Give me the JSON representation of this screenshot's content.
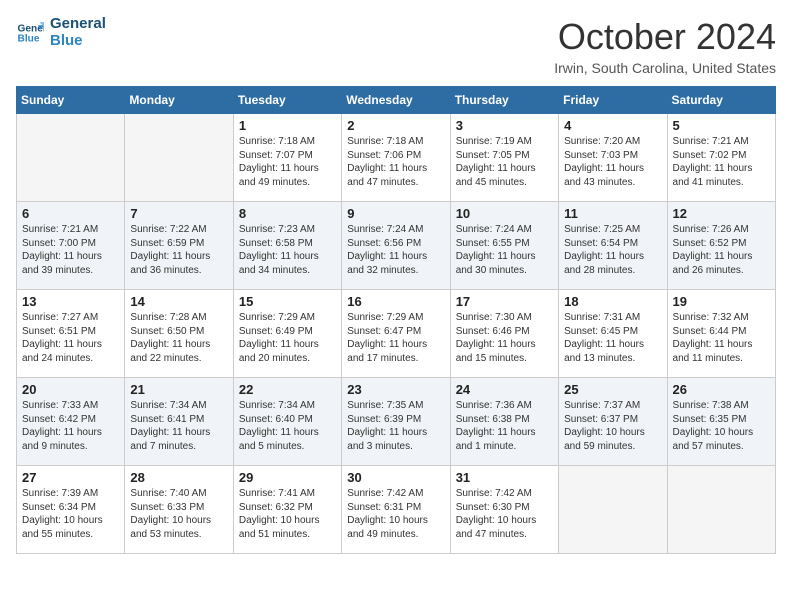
{
  "logo": {
    "line1": "General",
    "line2": "Blue"
  },
  "title": "October 2024",
  "subtitle": "Irwin, South Carolina, United States",
  "days_of_week": [
    "Sunday",
    "Monday",
    "Tuesday",
    "Wednesday",
    "Thursday",
    "Friday",
    "Saturday"
  ],
  "weeks": [
    [
      {
        "day": "",
        "sunrise": "",
        "sunset": "",
        "daylight": ""
      },
      {
        "day": "",
        "sunrise": "",
        "sunset": "",
        "daylight": ""
      },
      {
        "day": "1",
        "sunrise": "Sunrise: 7:18 AM",
        "sunset": "Sunset: 7:07 PM",
        "daylight": "Daylight: 11 hours and 49 minutes."
      },
      {
        "day": "2",
        "sunrise": "Sunrise: 7:18 AM",
        "sunset": "Sunset: 7:06 PM",
        "daylight": "Daylight: 11 hours and 47 minutes."
      },
      {
        "day": "3",
        "sunrise": "Sunrise: 7:19 AM",
        "sunset": "Sunset: 7:05 PM",
        "daylight": "Daylight: 11 hours and 45 minutes."
      },
      {
        "day": "4",
        "sunrise": "Sunrise: 7:20 AM",
        "sunset": "Sunset: 7:03 PM",
        "daylight": "Daylight: 11 hours and 43 minutes."
      },
      {
        "day": "5",
        "sunrise": "Sunrise: 7:21 AM",
        "sunset": "Sunset: 7:02 PM",
        "daylight": "Daylight: 11 hours and 41 minutes."
      }
    ],
    [
      {
        "day": "6",
        "sunrise": "Sunrise: 7:21 AM",
        "sunset": "Sunset: 7:00 PM",
        "daylight": "Daylight: 11 hours and 39 minutes."
      },
      {
        "day": "7",
        "sunrise": "Sunrise: 7:22 AM",
        "sunset": "Sunset: 6:59 PM",
        "daylight": "Daylight: 11 hours and 36 minutes."
      },
      {
        "day": "8",
        "sunrise": "Sunrise: 7:23 AM",
        "sunset": "Sunset: 6:58 PM",
        "daylight": "Daylight: 11 hours and 34 minutes."
      },
      {
        "day": "9",
        "sunrise": "Sunrise: 7:24 AM",
        "sunset": "Sunset: 6:56 PM",
        "daylight": "Daylight: 11 hours and 32 minutes."
      },
      {
        "day": "10",
        "sunrise": "Sunrise: 7:24 AM",
        "sunset": "Sunset: 6:55 PM",
        "daylight": "Daylight: 11 hours and 30 minutes."
      },
      {
        "day": "11",
        "sunrise": "Sunrise: 7:25 AM",
        "sunset": "Sunset: 6:54 PM",
        "daylight": "Daylight: 11 hours and 28 minutes."
      },
      {
        "day": "12",
        "sunrise": "Sunrise: 7:26 AM",
        "sunset": "Sunset: 6:52 PM",
        "daylight": "Daylight: 11 hours and 26 minutes."
      }
    ],
    [
      {
        "day": "13",
        "sunrise": "Sunrise: 7:27 AM",
        "sunset": "Sunset: 6:51 PM",
        "daylight": "Daylight: 11 hours and 24 minutes."
      },
      {
        "day": "14",
        "sunrise": "Sunrise: 7:28 AM",
        "sunset": "Sunset: 6:50 PM",
        "daylight": "Daylight: 11 hours and 22 minutes."
      },
      {
        "day": "15",
        "sunrise": "Sunrise: 7:29 AM",
        "sunset": "Sunset: 6:49 PM",
        "daylight": "Daylight: 11 hours and 20 minutes."
      },
      {
        "day": "16",
        "sunrise": "Sunrise: 7:29 AM",
        "sunset": "Sunset: 6:47 PM",
        "daylight": "Daylight: 11 hours and 17 minutes."
      },
      {
        "day": "17",
        "sunrise": "Sunrise: 7:30 AM",
        "sunset": "Sunset: 6:46 PM",
        "daylight": "Daylight: 11 hours and 15 minutes."
      },
      {
        "day": "18",
        "sunrise": "Sunrise: 7:31 AM",
        "sunset": "Sunset: 6:45 PM",
        "daylight": "Daylight: 11 hours and 13 minutes."
      },
      {
        "day": "19",
        "sunrise": "Sunrise: 7:32 AM",
        "sunset": "Sunset: 6:44 PM",
        "daylight": "Daylight: 11 hours and 11 minutes."
      }
    ],
    [
      {
        "day": "20",
        "sunrise": "Sunrise: 7:33 AM",
        "sunset": "Sunset: 6:42 PM",
        "daylight": "Daylight: 11 hours and 9 minutes."
      },
      {
        "day": "21",
        "sunrise": "Sunrise: 7:34 AM",
        "sunset": "Sunset: 6:41 PM",
        "daylight": "Daylight: 11 hours and 7 minutes."
      },
      {
        "day": "22",
        "sunrise": "Sunrise: 7:34 AM",
        "sunset": "Sunset: 6:40 PM",
        "daylight": "Daylight: 11 hours and 5 minutes."
      },
      {
        "day": "23",
        "sunrise": "Sunrise: 7:35 AM",
        "sunset": "Sunset: 6:39 PM",
        "daylight": "Daylight: 11 hours and 3 minutes."
      },
      {
        "day": "24",
        "sunrise": "Sunrise: 7:36 AM",
        "sunset": "Sunset: 6:38 PM",
        "daylight": "Daylight: 11 hours and 1 minute."
      },
      {
        "day": "25",
        "sunrise": "Sunrise: 7:37 AM",
        "sunset": "Sunset: 6:37 PM",
        "daylight": "Daylight: 10 hours and 59 minutes."
      },
      {
        "day": "26",
        "sunrise": "Sunrise: 7:38 AM",
        "sunset": "Sunset: 6:35 PM",
        "daylight": "Daylight: 10 hours and 57 minutes."
      }
    ],
    [
      {
        "day": "27",
        "sunrise": "Sunrise: 7:39 AM",
        "sunset": "Sunset: 6:34 PM",
        "daylight": "Daylight: 10 hours and 55 minutes."
      },
      {
        "day": "28",
        "sunrise": "Sunrise: 7:40 AM",
        "sunset": "Sunset: 6:33 PM",
        "daylight": "Daylight: 10 hours and 53 minutes."
      },
      {
        "day": "29",
        "sunrise": "Sunrise: 7:41 AM",
        "sunset": "Sunset: 6:32 PM",
        "daylight": "Daylight: 10 hours and 51 minutes."
      },
      {
        "day": "30",
        "sunrise": "Sunrise: 7:42 AM",
        "sunset": "Sunset: 6:31 PM",
        "daylight": "Daylight: 10 hours and 49 minutes."
      },
      {
        "day": "31",
        "sunrise": "Sunrise: 7:42 AM",
        "sunset": "Sunset: 6:30 PM",
        "daylight": "Daylight: 10 hours and 47 minutes."
      },
      {
        "day": "",
        "sunrise": "",
        "sunset": "",
        "daylight": ""
      },
      {
        "day": "",
        "sunrise": "",
        "sunset": "",
        "daylight": ""
      }
    ]
  ]
}
